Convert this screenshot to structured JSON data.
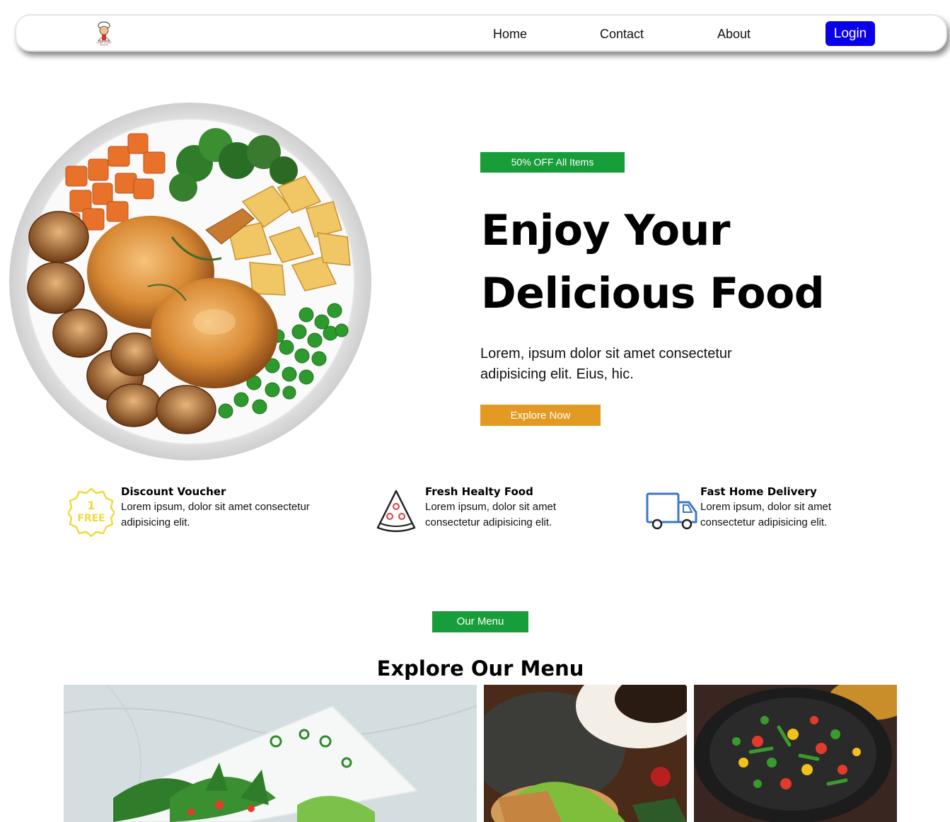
{
  "navbar": {
    "logo_text": "CHEF LOGO",
    "links": [
      "Home",
      "Contact",
      "About"
    ],
    "login_label": "Login"
  },
  "hero": {
    "promo_badge": "50% OFF All Items",
    "title_line1": "Enjoy Your",
    "title_line2": "Delicious Food",
    "description": "Lorem, ipsum dolor sit amet consectetur adipisicing elit. Eius, hic.",
    "cta_label": "Explore Now"
  },
  "features": [
    {
      "title": "Discount Voucher",
      "text": "Lorem ipsum, dolor sit amet consectetur adipisicing elit.",
      "icon": "voucher-icon",
      "icon_text_1": "1",
      "icon_text_2": "FREE"
    },
    {
      "title": "Fresh Healty Food",
      "text": "Lorem ipsum, dolor sit amet consectetur adipisicing elit.",
      "icon": "pizza-icon"
    },
    {
      "title": "Fast Home Delivery",
      "text": "Lorem ipsum, dolor sit amet consectetur adipisicing elit.",
      "icon": "delivery-truck-icon"
    }
  ],
  "menu": {
    "badge": "Our Menu",
    "title": "Explore Our Menu"
  },
  "colors": {
    "accent_green": "#179d3a",
    "accent_orange": "#e39a22",
    "login_blue": "#0a00e8"
  }
}
